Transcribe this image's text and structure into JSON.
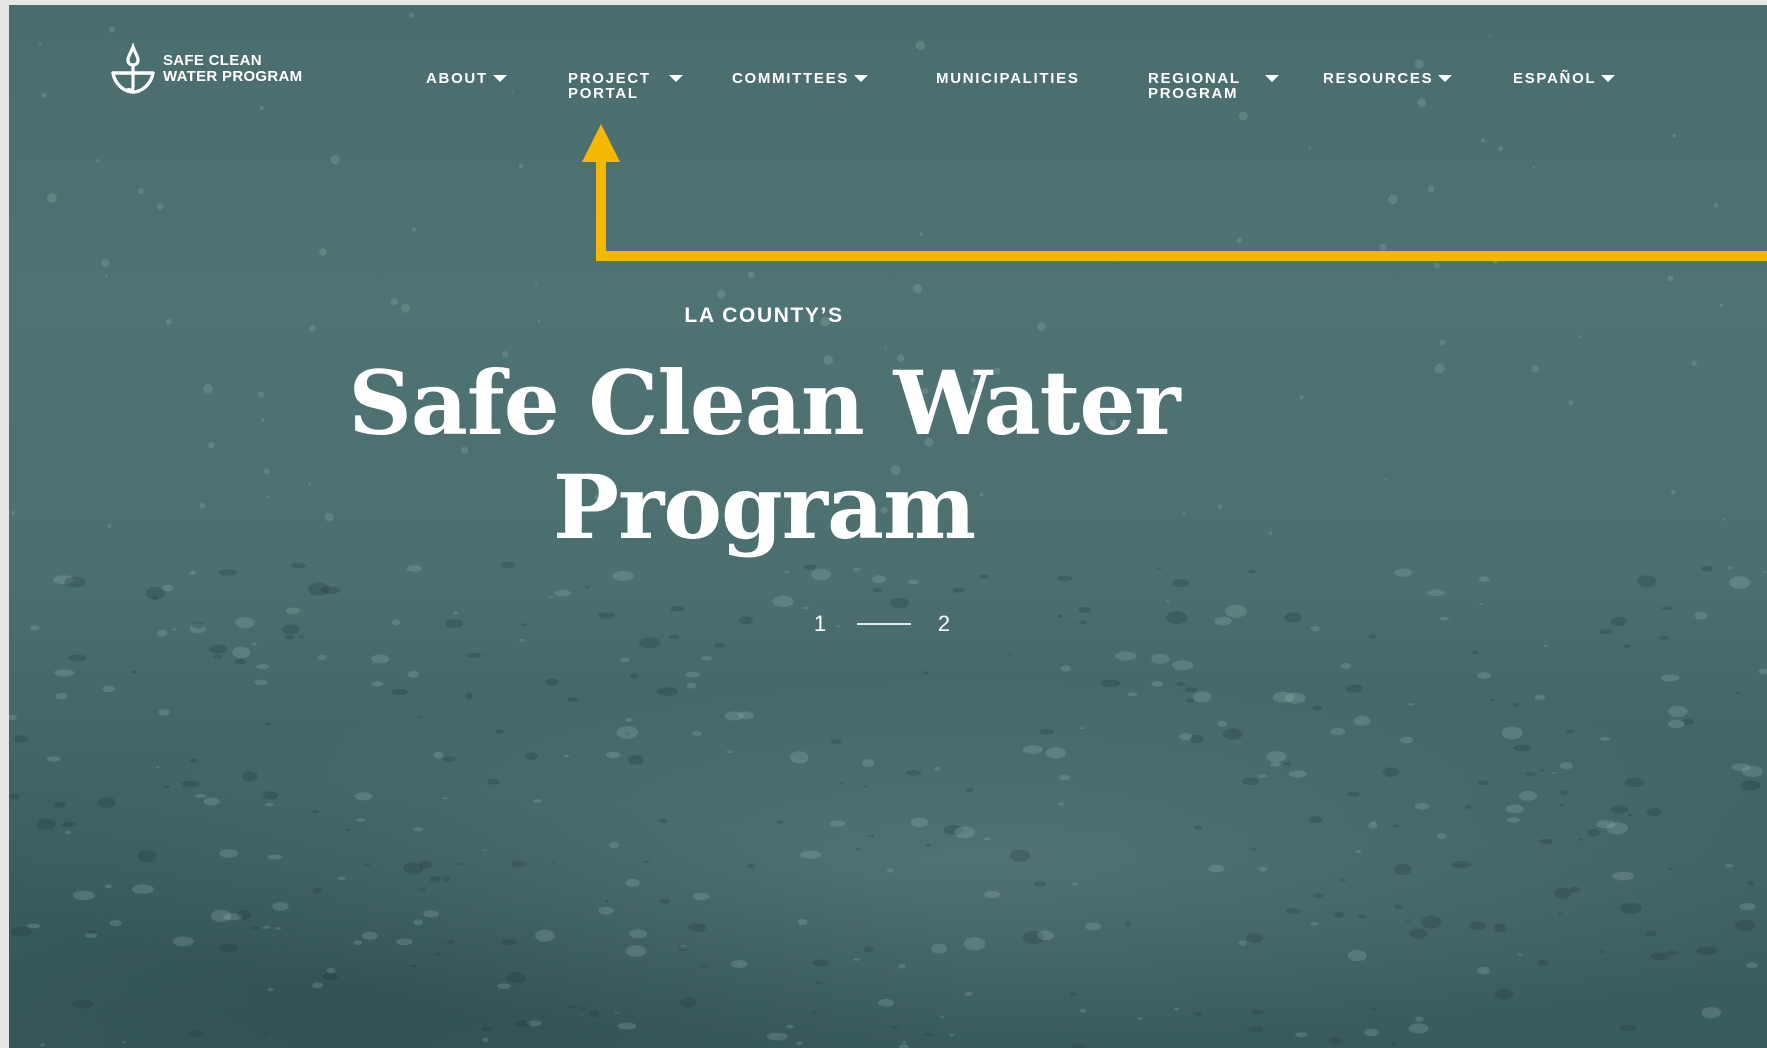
{
  "logo": {
    "line1": "SAFE CLEAN",
    "line2": "WATER PROGRAM",
    "icon": "umbrella-drop-icon"
  },
  "nav": {
    "items": [
      {
        "label": "ABOUT",
        "dropdown": true
      },
      {
        "label": "PROJECT PORTAL",
        "dropdown": true
      },
      {
        "label": "COMMITTEES",
        "dropdown": true
      },
      {
        "label": "MUNICIPALITIES",
        "dropdown": false
      },
      {
        "label": "REGIONAL PROGRAM",
        "dropdown": true
      },
      {
        "label": "RESOURCES",
        "dropdown": true
      },
      {
        "label": "ESPAÑOL",
        "dropdown": true
      }
    ]
  },
  "hero": {
    "eyebrow": "LA COUNTY’S",
    "title_line1": "Safe Clean Water",
    "title_line2": "Program"
  },
  "pager": {
    "first": "1",
    "second": "2"
  },
  "colors": {
    "annotation": "#f5b700",
    "background": "#4c6f70",
    "text": "#ffffff"
  }
}
